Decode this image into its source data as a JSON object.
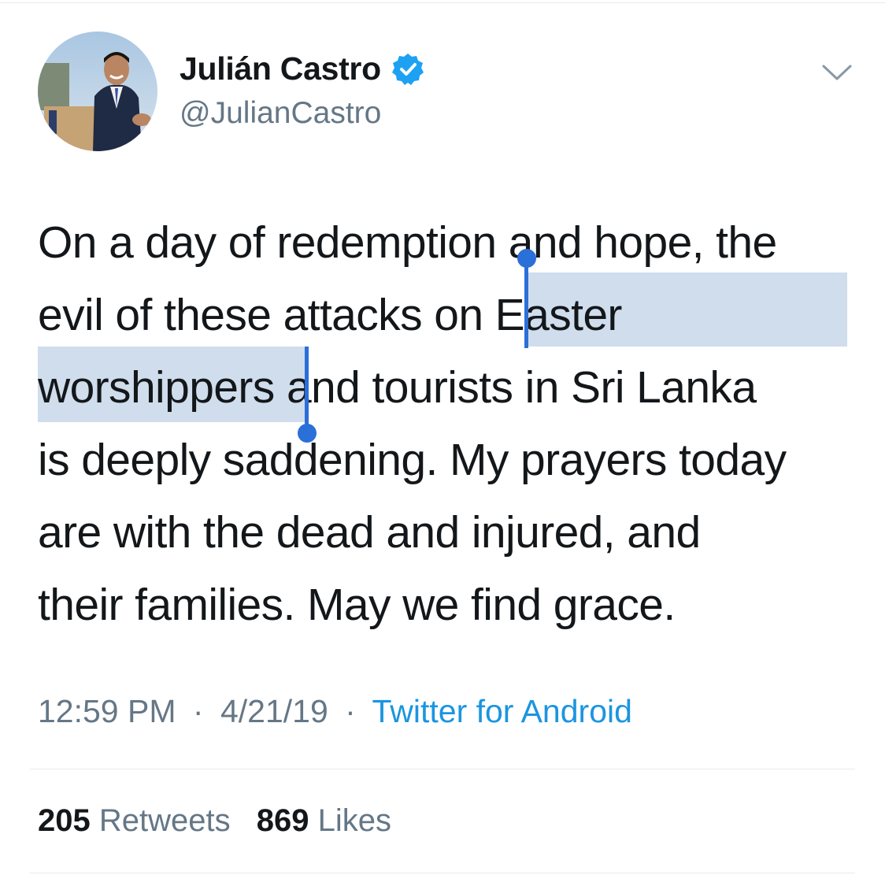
{
  "user": {
    "display_name": "Julián Castro",
    "handle": "@JulianCastro",
    "verified": true
  },
  "tweet": {
    "lines": [
      [
        "On a day of redemption and hope, the"
      ],
      [
        "evil of these attacks on ",
        "Easter"
      ],
      [
        "worshippers",
        " and tourists in Sri Lanka"
      ],
      [
        "is deeply saddening. My prayers today"
      ],
      [
        "are with the dead and injured, and"
      ],
      [
        "their families. May we find grace."
      ]
    ],
    "selected_text": "Easter worshippers"
  },
  "meta": {
    "time": "12:59 PM",
    "separator": "·",
    "date": "4/21/19",
    "source": "Twitter for Android"
  },
  "stats": {
    "retweets_count": "205",
    "retweets_label": "Retweets",
    "likes_count": "869",
    "likes_label": "Likes"
  },
  "icons": {
    "verified": "verified-badge-icon",
    "menu": "chevron-down-icon"
  },
  "colors": {
    "link": "#1b95e0",
    "verified": "#1da1f2",
    "selection": "#cfddec",
    "selection_handle": "#2b6fd8",
    "secondary_text": "#657786"
  }
}
